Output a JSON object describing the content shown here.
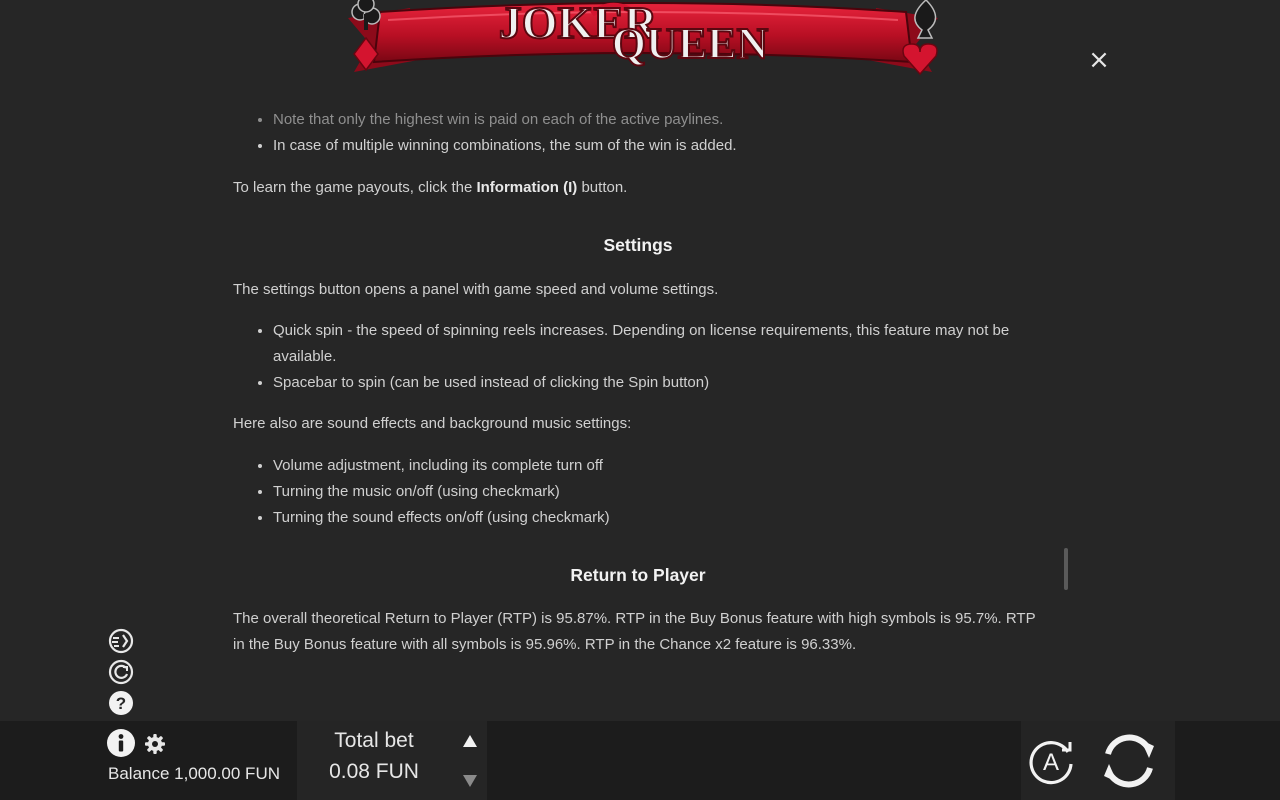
{
  "header": {
    "logo_line1": "JOKER",
    "logo_line2": "QUEEN",
    "close_label": "×"
  },
  "rules": {
    "top_bullets": [
      "Note that only the highest win is paid on each of the active paylines.",
      "In case of multiple winning combinations, the sum of the win is added."
    ],
    "payouts_prefix": "To learn the game payouts, click the ",
    "payouts_bold": "Information (I)",
    "payouts_suffix": " button.",
    "settings_title": "Settings",
    "settings_intro": "The settings button opens a panel with game speed and volume settings.",
    "settings_bullets": [
      "Quick spin - the speed of spinning reels increases. Depending on license requirements, this feature may not be available.",
      "Spacebar to spin (can be used instead of clicking the Spin button)"
    ],
    "sound_intro": "Here also are sound effects and background music settings:",
    "sound_bullets": [
      "Volume adjustment, including its complete turn off",
      "Turning the music on/off (using checkmark)",
      "Turning the sound effects on/off (using checkmark)"
    ],
    "rtp_title": "Return to Player",
    "rtp_text": "The overall theoretical Return to Player (RTP) is 95.87%. RTP in the Buy Bonus feature with high symbols is 95.7%. RTP in the Buy Bonus feature with all symbols is 95.96%. RTP in the Chance x2 feature is 96.33%."
  },
  "footer": {
    "balance": "Balance 1,000.00 FUN",
    "bet_label": "Total bet",
    "bet_value": "0.08 FUN",
    "auto_label": "A"
  },
  "colors": {
    "background": "#262626",
    "ribbon_red": "#c8102e",
    "text": "#d0d0d0"
  }
}
